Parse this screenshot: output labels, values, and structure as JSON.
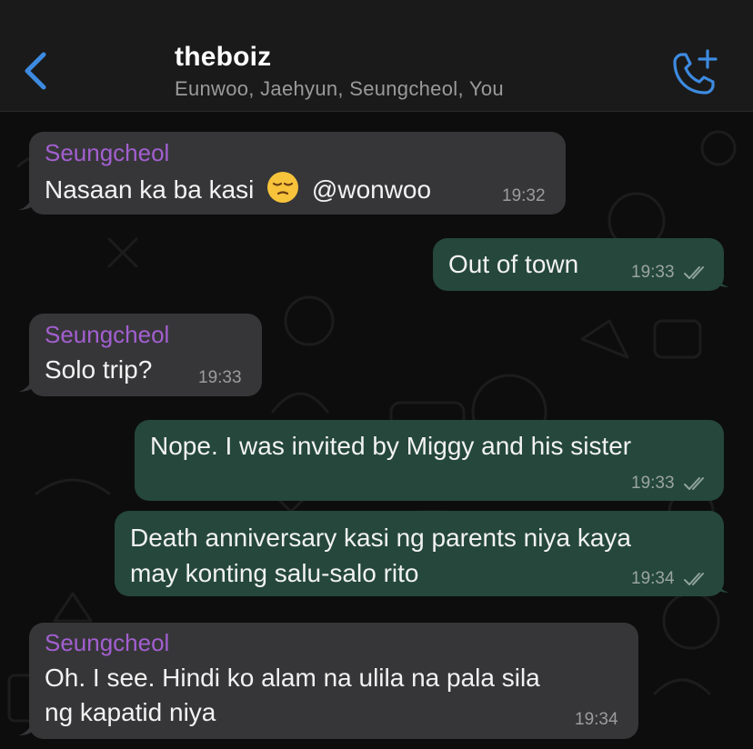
{
  "header": {
    "title": "theboiz",
    "subtitle": "Eunwoo, Jaehyun, Seungcheol, You",
    "accent_color": "#3d8be0"
  },
  "messages": [
    {
      "direction": "incoming",
      "sender": "Seungcheol",
      "text_before_emoji": "Nasaan ka ba kasi",
      "emoji": "pensive-face",
      "text_after_emoji": "@wonwoo",
      "time": "19:32"
    },
    {
      "direction": "outgoing",
      "text": "Out of town",
      "time": "19:33",
      "status": "read-double-tick"
    },
    {
      "direction": "incoming",
      "sender": "Seungcheol",
      "text": "Solo trip?",
      "time": "19:33"
    },
    {
      "direction": "outgoing",
      "text": "Nope. I was invited by Miggy and his sister",
      "time": "19:33",
      "status": "read-double-tick"
    },
    {
      "direction": "outgoing",
      "lines": [
        "Death anniversary kasi ng parents niya kaya",
        "may konting salu-salo rito"
      ],
      "time": "19:34",
      "status": "read-double-tick"
    },
    {
      "direction": "incoming",
      "sender": "Seungcheol",
      "lines": [
        "Oh. I see. Hindi ko alam na ulila na pala sila",
        "ng kapatid niya"
      ],
      "time": "19:34"
    }
  ],
  "colors": {
    "incoming_bubble": "#363638",
    "outgoing_bubble": "#25473c",
    "sender_name": "#a35fd0",
    "background": "#0d0d0d"
  }
}
